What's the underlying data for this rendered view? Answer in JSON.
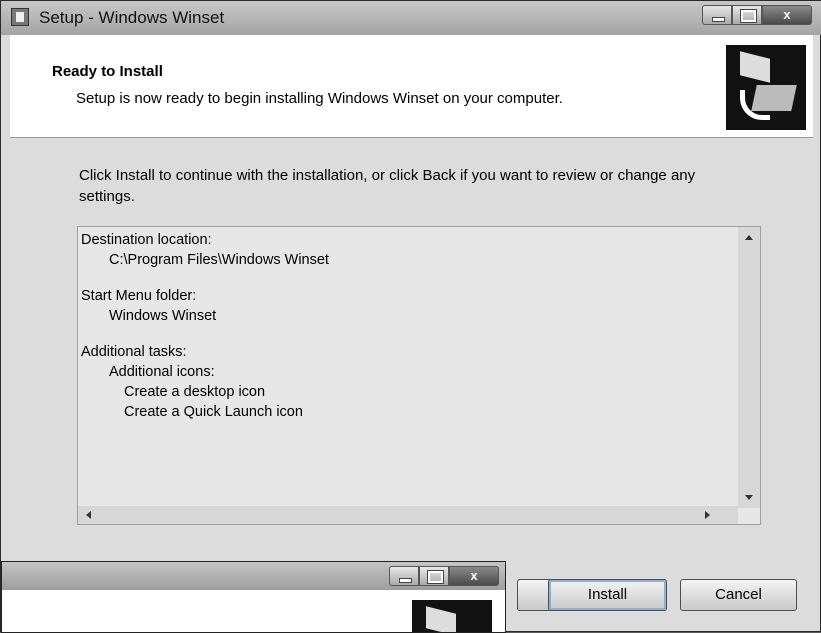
{
  "window": {
    "title": "Setup - Windows Winset",
    "close_label": "x"
  },
  "header": {
    "title": "Ready to Install",
    "subtitle": "Setup is now ready to begin installing Windows Winset on your computer.",
    "logo_icon": "installer-box-icon"
  },
  "content": {
    "intro": "Click Install to continue with the installation, or click Back if you want to review or change any settings.",
    "summary": {
      "destination_label": "Destination location:",
      "destination_value": "C:\\Program Files\\Windows Winset",
      "start_menu_label": "Start Menu folder:",
      "start_menu_value": "Windows Winset",
      "tasks_label": "Additional tasks:",
      "tasks_group": "Additional icons:",
      "task_1": "Create a desktop icon",
      "task_2": "Create a Quick Launch icon"
    }
  },
  "buttons": {
    "install": "Install",
    "cancel": "Cancel"
  },
  "overlay_window": {
    "close_label": "x"
  }
}
